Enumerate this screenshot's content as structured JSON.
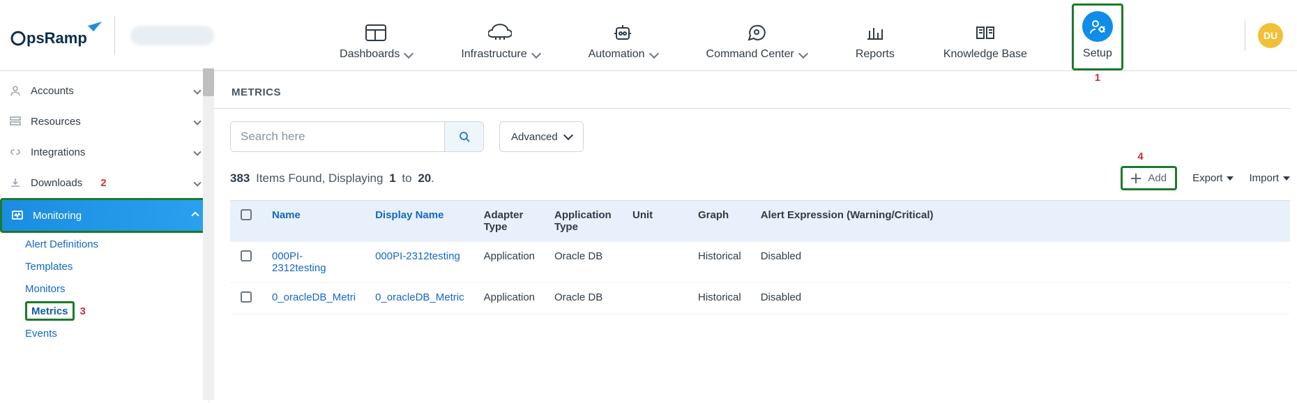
{
  "brand": {
    "name": "OpsRamp"
  },
  "annotations": {
    "a1": "1",
    "a2": "2",
    "a3": "3",
    "a4": "4"
  },
  "nav": {
    "dashboards": "Dashboards",
    "infrastructure": "Infrastructure",
    "automation": "Automation",
    "command_center": "Command Center",
    "reports": "Reports",
    "knowledge_base": "Knowledge Base",
    "setup": "Setup"
  },
  "avatar": {
    "initials": "DU"
  },
  "sidebar": {
    "items": [
      {
        "label": "Accounts"
      },
      {
        "label": "Resources"
      },
      {
        "label": "Integrations"
      },
      {
        "label": "Downloads"
      },
      {
        "label": "Monitoring"
      }
    ],
    "monitoring_sub": [
      {
        "label": "Alert Definitions"
      },
      {
        "label": "Templates"
      },
      {
        "label": "Monitors"
      },
      {
        "label": "Metrics"
      },
      {
        "label": "Events"
      }
    ]
  },
  "page": {
    "title": "METRICS"
  },
  "search": {
    "placeholder": "Search here"
  },
  "advanced": {
    "label": "Advanced"
  },
  "count": {
    "total": "383",
    "mid": "Items Found, Displaying",
    "from": "1",
    "to_word": "to",
    "to": "20",
    "dot": "."
  },
  "actions": {
    "add": "Add",
    "export": "Export",
    "import": "Import"
  },
  "table": {
    "headers": {
      "name": "Name",
      "display_name": "Display Name",
      "adapter_type": "Adapter Type",
      "application_type": "Application Type",
      "unit": "Unit",
      "graph": "Graph",
      "alert_expr": "Alert Expression (Warning/Critical)"
    },
    "rows": [
      {
        "name": "000PI-2312testing",
        "display_name": "000PI-2312testing",
        "adapter_type": "Application",
        "application_type": "Oracle DB",
        "unit": "",
        "graph": "Historical",
        "alert_expr": "Disabled"
      },
      {
        "name": "0_oracleDB_Metri",
        "display_name": "0_oracleDB_Metric",
        "adapter_type": "Application",
        "application_type": "Oracle DB",
        "unit": "",
        "graph": "Historical",
        "alert_expr": "Disabled"
      }
    ]
  }
}
